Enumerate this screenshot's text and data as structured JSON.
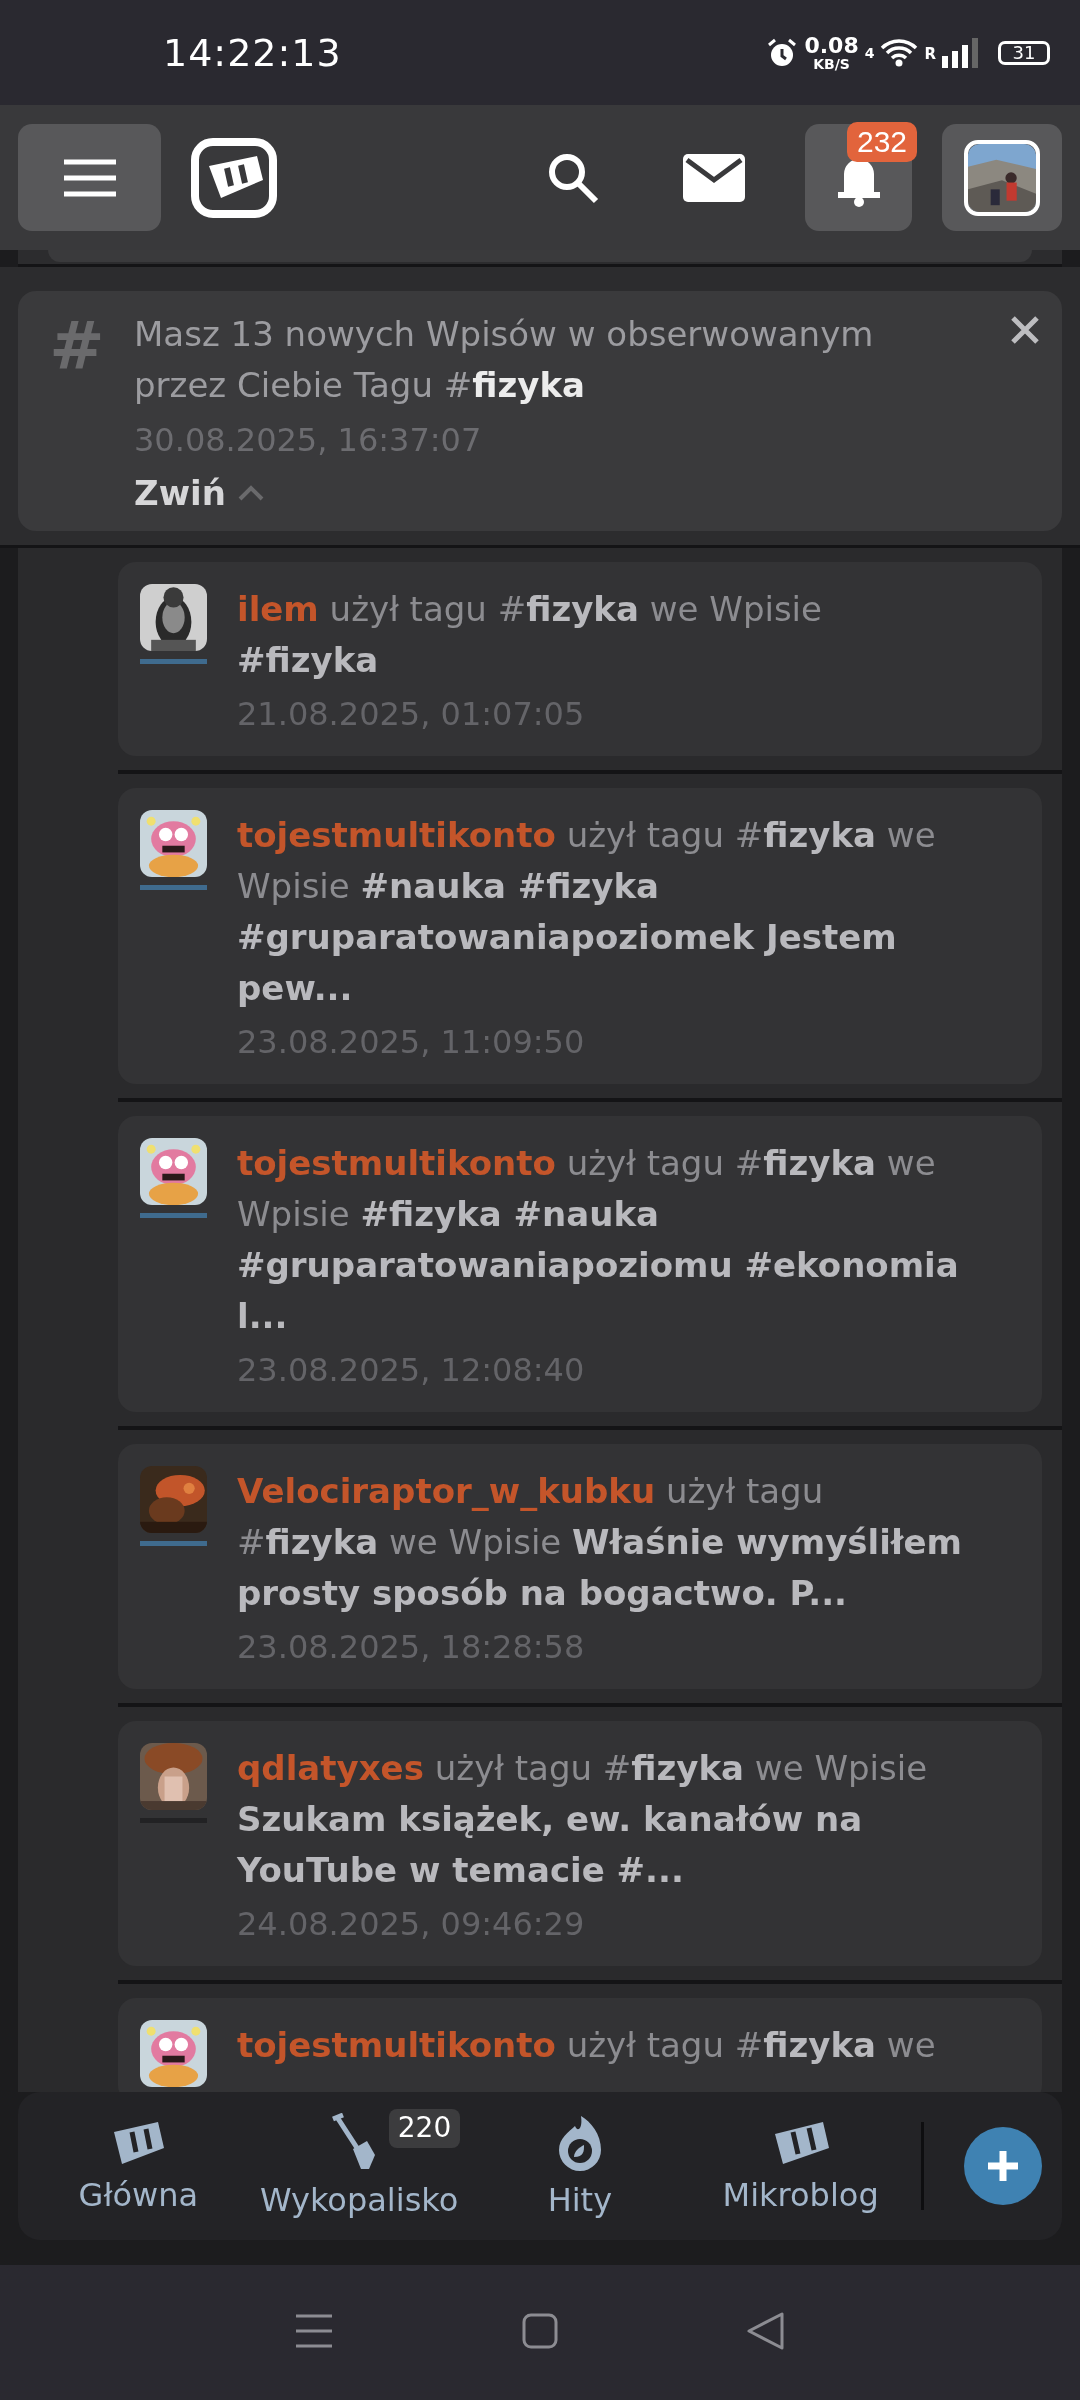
{
  "status_bar": {
    "time": "14:22:13",
    "speed_value": "0.08",
    "speed_unit": "KB/S",
    "network_type": "4",
    "roaming": "R",
    "battery": "31"
  },
  "header": {
    "notifications_count": "232"
  },
  "notice": {
    "icon": "#",
    "text": "Masz 13 nowych Wpisów w obserwowanym przez Ciebie Tagu #**fizyka**",
    "time": "30.08.2025, 16:37:07",
    "collapse": "Zwiń"
  },
  "entries": [
    {
      "author": "ilem",
      "text": "użył tagu #**fizyka** we Wpisie **#fizyka**",
      "time": "21.08.2025, 01:07:05",
      "color": "#3f6b8e"
    },
    {
      "author": "tojestmultikonto",
      "text": "użył tagu #**fizyka** we Wpisie **#nauka #fizyka #gruparatowaniapoziomek Jestem pew...**",
      "time": "23.08.2025, 11:09:50",
      "color": "#3f6b8e"
    },
    {
      "author": "tojestmultikonto",
      "text": "użył tagu #**fizyka** we Wpisie **#fizyka #nauka #gruparatowaniapoziomu #ekonomia l...**",
      "time": "23.08.2025, 12:08:40",
      "color": "#3f6b8e"
    },
    {
      "author": "Velociraptor_w_kubku",
      "text": "użył tagu #**fizyka** we Wpisie **Właśnie wymyśliłem prosty sposób na bogactwo. P...**",
      "time": "23.08.2025, 18:28:58",
      "color": "#3f6b8e"
    },
    {
      "author": "qdlatyxes",
      "text": "użył tagu #**fizyka** we Wpisie **Szukam książek, ew. kanałów na YouTube w temacie #...**",
      "time": "24.08.2025, 09:46:29",
      "color": "#222224"
    },
    {
      "author": "tojestmultikonto",
      "text": "użył tagu #**fizyka** we"
    }
  ],
  "bottom_nav": {
    "items": [
      {
        "label": "Główna"
      },
      {
        "label": "Wykopalisko",
        "badge": "220"
      },
      {
        "label": "Hity"
      },
      {
        "label": "Mikroblog"
      }
    ]
  }
}
